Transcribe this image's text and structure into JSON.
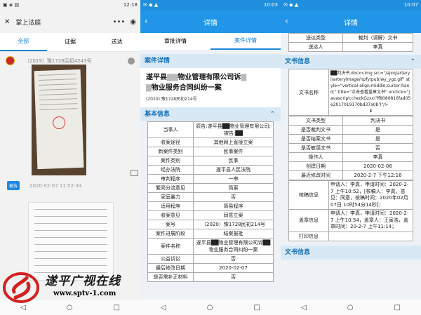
{
  "p1": {
    "time": "12:18",
    "title": "掌上法庭",
    "tabs": [
      "全部",
      "证据",
      "送达"
    ],
    "case_no": "（2019）豫1728民初4243号",
    "msg_badge": "被告",
    "msg_time": "2020-02-07 11:52:34"
  },
  "p2": {
    "time": "10:03",
    "title": "详情",
    "subtabs": [
      "审批详情",
      "案件详情"
    ],
    "section1": "案件详情",
    "case_title_a": "遂平县",
    "case_title_b": "物业管理有限公司诉",
    "case_title_c": "物业服务合同纠纷一案",
    "case_no": "(2020) 豫1728民初214号",
    "section2": "基本信息",
    "rows": [
      {
        "k": "当事人",
        "v": "原告:遂平县██物业管理有限公司;被告:██"
      },
      {
        "k": "收案途径",
        "v": "其他网上直接立案"
      },
      {
        "k": "新案件类别",
        "v": "民事案件"
      },
      {
        "k": "案件类别",
        "v": "民事"
      },
      {
        "k": "经办法院",
        "v": "遂平县人民法院"
      },
      {
        "k": "审判程序",
        "v": "一审"
      },
      {
        "k": "繁简分流意见",
        "v": "简案"
      },
      {
        "k": "家庭暴力",
        "v": "否"
      },
      {
        "k": "适用程序",
        "v": "简易程序"
      },
      {
        "k": "收案意见",
        "v": "同意立案"
      },
      {
        "k": "案号",
        "v": "（2020）豫1728民初214号"
      },
      {
        "k": "案件进展阶段",
        "v": "结案报批"
      },
      {
        "k": "案件名称",
        "v": "遂平县██物业管理有限公司诉██物业服务合同纠纷一案"
      },
      {
        "k": "公益诉讼",
        "v": "否"
      },
      {
        "k": "最后修改日期",
        "v": "2020-02-07"
      },
      {
        "k": "是否需补正材料",
        "v": "否"
      }
    ]
  },
  "p3": {
    "time": "10:07",
    "title": "详情",
    "top_rows": [
      {
        "k": "送达类型",
        "v": "裁判（调解）文书"
      },
      {
        "k": "送达人",
        "v": "李真"
      }
    ],
    "section": "文书信息",
    "doc_name_k": "文书名称",
    "doc_name_v": "██判决书.docx<img src=\"/ajxq/arteryl/arteryImage/npfy/pub/wy_ygz.gif\" style=\"vertical-align:middle;cursor:hand;\" title=\"点击查看盖章文书\" onclick=\"javascript:checkGzxx('ff8080816fad05e2017019170bd37a0b')\"/>",
    "rows": [
      {
        "k": "文书类型",
        "v": "判决书"
      },
      {
        "k": "是否裁判文书",
        "v": "是"
      },
      {
        "k": "是否结案文书",
        "v": "是"
      },
      {
        "k": "是否敏感文书",
        "v": "否"
      },
      {
        "k": "操作人",
        "v": "李真"
      },
      {
        "k": "创建日期",
        "v": "2020-02-06"
      },
      {
        "k": "最近修改时间",
        "v": "2020-2-7 下午12:16"
      }
    ],
    "hexin_k": "核稿信息",
    "hexin_v": "申请人：李真，申请时间：2020-2-7 上午10:52，[核稿人：李真，意见：同意，核稿时间：2020年02月07日 10时54分14秒]；",
    "gaizhang_k": "盖章信息",
    "gaizhang_v": "申请人：李真，申请时间：2020-2-7 上午10:54，盖章人：王寅浩，盖章时间：20-2-7 上午11:14；",
    "print_k": "打印信息",
    "section_bottom": "文书信息"
  },
  "watermark": {
    "text": "遂平广视在线",
    "url": "www.sptv-1.com"
  }
}
